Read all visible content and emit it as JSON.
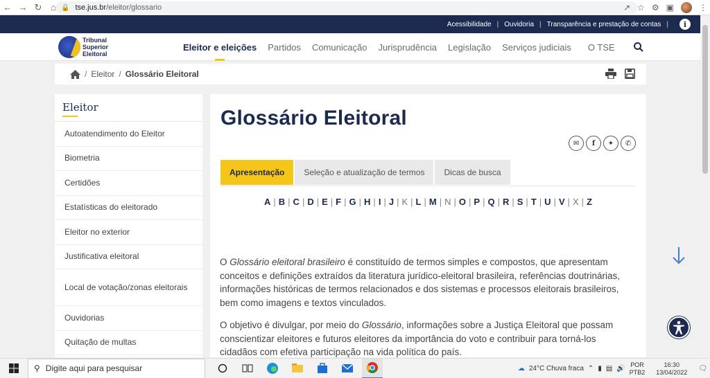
{
  "browser": {
    "url_host": "tse.jus.br",
    "url_path": "/eleitor/glossario"
  },
  "util_bar": {
    "links": [
      "Acessibilidade",
      "Ouvidoria",
      "Transparência e prestação de contas"
    ]
  },
  "logo": {
    "line1": "Tribunal",
    "line2": "Superior",
    "line3": "Eleitoral"
  },
  "nav": {
    "items": [
      "Eleitor e eleições",
      "Partidos",
      "Comunicação",
      "Jurisprudência",
      "Legislação",
      "Serviços judiciais",
      "O TSE"
    ]
  },
  "breadcrumb": {
    "parent": "Eleitor",
    "current": "Glossário Eleitoral"
  },
  "sidebar": {
    "title": "Eleitor",
    "items": [
      "Autoatendimento do Eleitor",
      "Biometria",
      "Certidões",
      "Estatísticas do eleitorado",
      "Eleitor no exterior",
      "Justificativa eleitoral",
      "Local de votação/zonas eleitorais",
      "Ouvidorias",
      "Quitação de multas"
    ]
  },
  "content": {
    "title": "Glossário Eleitoral",
    "tabs": [
      "Apresentação",
      "Seleção e atualização de termos",
      "Dicas de busca"
    ],
    "letters": [
      "A",
      "B",
      "C",
      "D",
      "E",
      "F",
      "G",
      "H",
      "I",
      "J",
      "K",
      "L",
      "M",
      "N",
      "O",
      "P",
      "Q",
      "R",
      "S",
      "T",
      "U",
      "V",
      "X",
      "Z"
    ],
    "disabled_letters": [
      "K",
      "N",
      "X"
    ],
    "p1_pre": "O ",
    "p1_em": "Glossário eleitoral brasileiro",
    "p1_post": " é constituído de termos simples e compostos, que apresentam conceitos e definições extraídos da literatura jurídico-eleitoral brasileira, referências doutrinárias, informações históricas de termos relacionados e dos sistemas e processos eleitorais brasileiros, bem como imagens e textos vinculados.",
    "p2_pre": "O objetivo é divulgar, por meio do ",
    "p2_em": "Glossário",
    "p2_post": ", informações sobre a Justiça Eleitoral que possam conscientizar eleitores e futuros eleitores da importância do voto e contribuir para torná-los cidadãos com efetiva participação na vida política do país."
  },
  "taskbar": {
    "search_placeholder": "Digite aqui para pesquisar",
    "weather": "24°C  Chuva fraca",
    "lang1": "POR",
    "lang2": "PTB2",
    "time": "16:30",
    "date": "13/04/2022"
  },
  "colors": {
    "navy": "#1c2a4f",
    "yellow": "#f5c518"
  }
}
